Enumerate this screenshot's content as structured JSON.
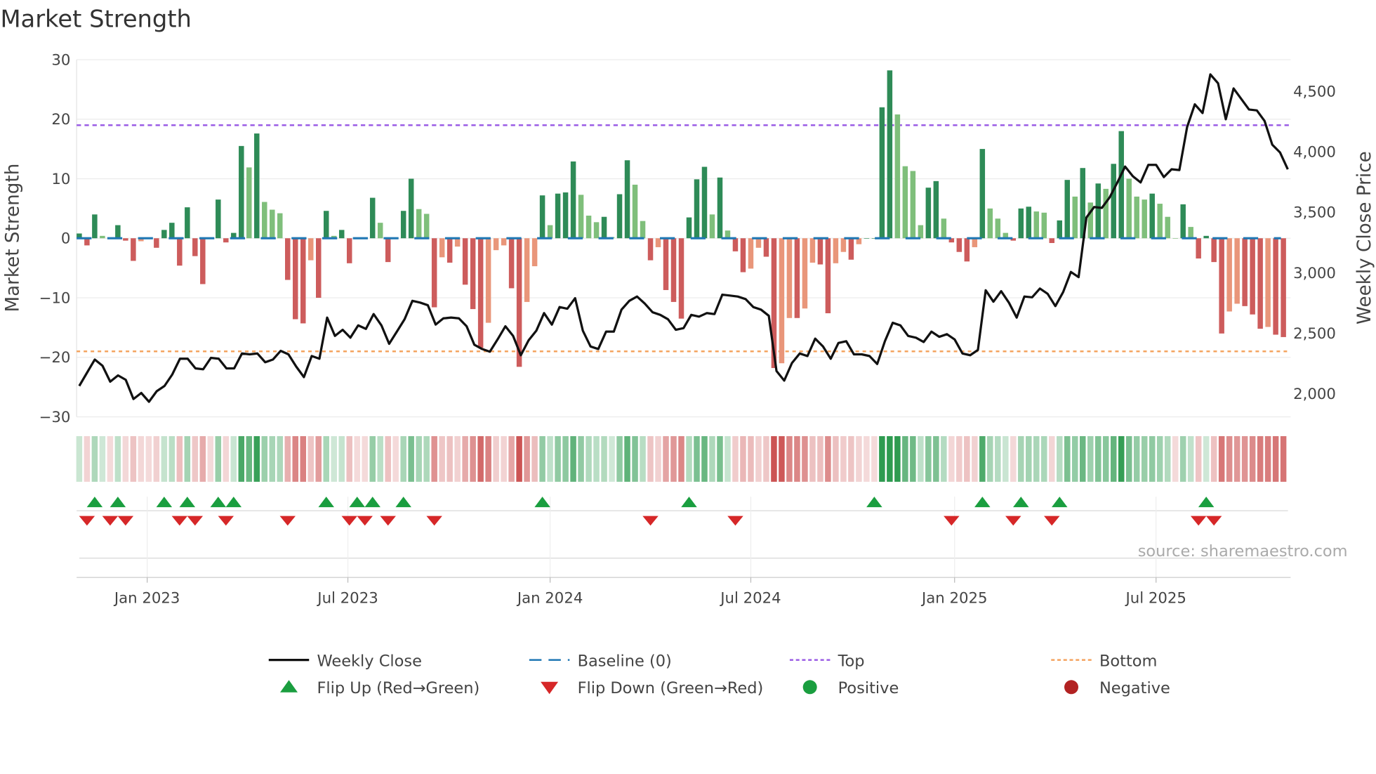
{
  "chart_data": {
    "type": "bar",
    "title": "Market Strength",
    "ylabel": "Market Strength",
    "y2label": "Weekly Close Price",
    "frequency": "weekly",
    "ylim": [
      -30,
      30
    ],
    "y2lim": [
      1810,
      4760
    ],
    "yticks": [
      30,
      20,
      10,
      0,
      -10,
      -20,
      -30
    ],
    "ytick_labels": [
      "30",
      "20",
      "10",
      "0",
      "−10",
      "−20",
      "−30"
    ],
    "y2ticks": [
      4500,
      4000,
      3500,
      3000,
      2500,
      2000
    ],
    "y2tick_labels": [
      "4,500",
      "4,000",
      "3,500",
      "3,000",
      "2,500",
      "2,000"
    ],
    "xtick_labels": [
      "Jan 2023",
      "Jul 2023",
      "Jan 2024",
      "Jul 2024",
      "Jan 2025",
      "Jul 2025"
    ],
    "xtick_week_index": [
      8.8,
      34.8,
      61,
      87,
      113.4,
      139.5
    ],
    "top": 19,
    "bottom": -19,
    "baseline": 0,
    "strength": [
      0.8,
      -1.2,
      4,
      0.4,
      0,
      2.2,
      -0.4,
      -3.8,
      -0.5,
      0,
      -1.6,
      1.4,
      2.6,
      -4.6,
      5.2,
      -3,
      -7.7,
      0,
      6.5,
      -0.7,
      0.9,
      15.5,
      11.9,
      17.6,
      6.1,
      4.8,
      4.2,
      -7,
      -13.6,
      -14.3,
      -3.7,
      -10,
      4.6,
      0.4,
      1.4,
      -4.2,
      0,
      0,
      6.8,
      2.6,
      -4,
      -0.1,
      4.6,
      10,
      4.9,
      4.1,
      -11.6,
      -3.2,
      -4.1,
      -1.4,
      -7.8,
      -11.9,
      -18.4,
      -14.2,
      -2,
      -1.2,
      -8.4,
      -21.6,
      -10.7,
      -4.7,
      7.2,
      2.2,
      7.5,
      7.7,
      12.9,
      7.3,
      3.8,
      2.7,
      3.6,
      0.2,
      7.4,
      13.1,
      9,
      2.9,
      -3.7,
      -1.5,
      -8.7,
      -10.7,
      -13.5,
      3.5,
      9.9,
      12,
      4,
      10.2,
      1.3,
      -2.2,
      -5.7,
      -5.1,
      -1.6,
      -3.1,
      -21.8,
      -21,
      -13.4,
      -13.4,
      -11.8,
      -4.1,
      -4.4,
      -12.6,
      -4.2,
      -2.3,
      -3.6,
      -1,
      0,
      0,
      22,
      28.2,
      20.8,
      12.1,
      11.3,
      2.2,
      8.5,
      9.6,
      3.3,
      -0.7,
      -2.3,
      -3.9,
      -1.5,
      15,
      5,
      3.3,
      0.9,
      -0.4,
      5,
      5.3,
      4.5,
      4.3,
      -0.8,
      3,
      9.8,
      7,
      11.8,
      6,
      9.2,
      8.3,
      12.5,
      18,
      10,
      7,
      6.5,
      7.5,
      5.8,
      3.6,
      0,
      5.7,
      1.9,
      -3.4,
      0.4,
      -4,
      -16,
      -12.3,
      -11,
      -11.4,
      -12.8,
      -15.2,
      -14.9,
      -16.2,
      -16.6
    ],
    "weekly_close": [
      2065,
      2174,
      2283,
      2232,
      2101,
      2152,
      2116,
      1957,
      2007,
      1935,
      2022,
      2065,
      2159,
      2290,
      2290,
      2210,
      2203,
      2297,
      2290,
      2210,
      2210,
      2333,
      2326,
      2333,
      2261,
      2283,
      2355,
      2326,
      2225,
      2138,
      2312,
      2290,
      2630,
      2478,
      2529,
      2464,
      2565,
      2536,
      2659,
      2565,
      2413,
      2514,
      2616,
      2768,
      2754,
      2732,
      2572,
      2623,
      2630,
      2623,
      2558,
      2406,
      2370,
      2348,
      2449,
      2558,
      2478,
      2319,
      2442,
      2522,
      2667,
      2572,
      2717,
      2703,
      2790,
      2522,
      2391,
      2370,
      2514,
      2514,
      2696,
      2768,
      2804,
      2746,
      2674,
      2652,
      2616,
      2529,
      2543,
      2652,
      2638,
      2667,
      2659,
      2819,
      2812,
      2804,
      2783,
      2717,
      2696,
      2645,
      2188,
      2109,
      2254,
      2333,
      2312,
      2456,
      2391,
      2290,
      2420,
      2435,
      2326,
      2326,
      2312,
      2246,
      2435,
      2587,
      2565,
      2478,
      2464,
      2428,
      2514,
      2471,
      2493,
      2449,
      2333,
      2319,
      2362,
      2855,
      2761,
      2848,
      2754,
      2630,
      2804,
      2797,
      2870,
      2826,
      2725,
      2841,
      3007,
      2964,
      3456,
      3543,
      3536,
      3623,
      3746,
      3877,
      3797,
      3746,
      3891,
      3891,
      3790,
      3855,
      3848,
      4203,
      4391,
      4319,
      4638,
      4565,
      4268,
      4522,
      4435,
      4348,
      4341,
      4254,
      4058,
      3993,
      3855
    ],
    "flip_up_week_index": [
      2,
      5,
      11,
      14,
      18,
      20,
      32,
      36,
      38,
      42,
      60,
      79,
      103,
      117,
      122,
      127,
      146
    ],
    "flip_down_week_index": [
      1,
      4,
      6,
      13,
      15,
      19,
      27,
      35,
      37,
      40,
      46,
      74,
      85,
      113,
      121,
      126,
      145,
      147
    ],
    "legend": {
      "placement": "bottom",
      "items": [
        "Weekly Close",
        "Baseline (0)",
        "Top",
        "Bottom",
        "Flip Up (Red→Green)",
        "Flip Down (Green→Red)",
        "Positive",
        "Negative"
      ]
    },
    "colors": {
      "strong_up": "#2e8b57",
      "weak_up": "#7fbf7b",
      "strong_down": "#cd5c5c",
      "weak_down": "#e9967a",
      "close": "#111111",
      "baseline": "#1f77b4",
      "top": "#9b5de5",
      "bottom": "#f4a460",
      "flip_up": "#1a9e3f",
      "flip_down": "#d62728",
      "positive": "#1a9e3f",
      "negative": "#b22222"
    },
    "source": "source: sharemaestro.com"
  }
}
